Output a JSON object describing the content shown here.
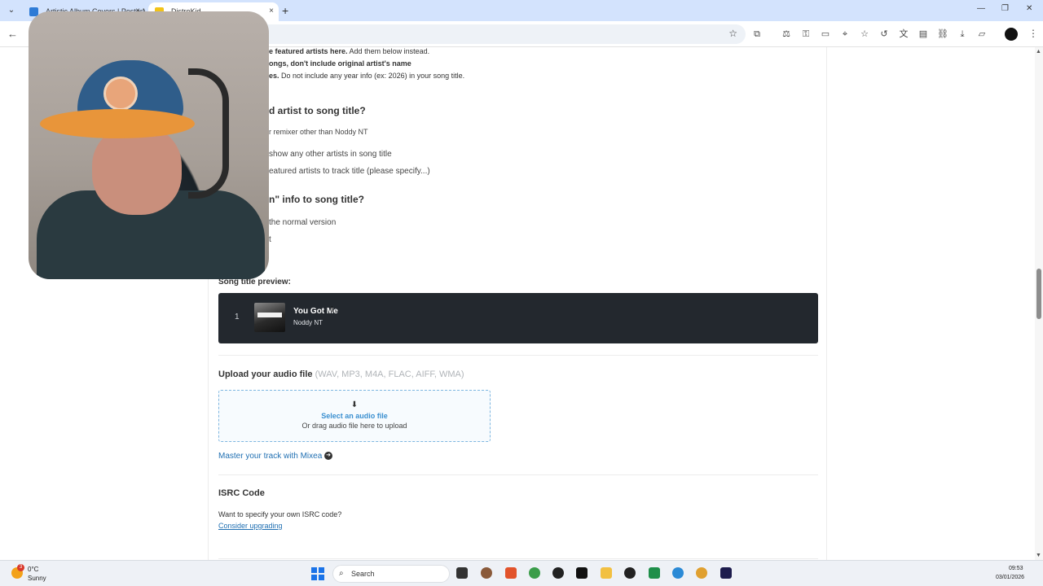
{
  "browser": {
    "tabs": [
      {
        "title": "Artistic Album Covers | PosterM"
      },
      {
        "title": "DistroKid"
      }
    ],
    "new_tab": "+",
    "tab_close": "×"
  },
  "form": {
    "rules": [
      {
        "bold": "e featured artists here.",
        "text": " Add them below instead."
      },
      {
        "bold": "ongs, don't include original artist's name",
        "text": ""
      },
      {
        "bold": "es.",
        "text": " Do not include any year info (ex: 2026) in your song title."
      }
    ],
    "question_artist": "d artist to song title?",
    "artist_options": [
      "r remixer other than Noddy NT",
      "show any other artists in song title",
      "eatured artists to track title (please specify...)"
    ],
    "question_version": "n\" info to song title?",
    "version_options": [
      "the normal version",
      "t"
    ],
    "preview_label": "Song title preview:",
    "preview": {
      "track_number": "1",
      "title": "You Got Me",
      "artist": "Noddy NT"
    },
    "upload": {
      "heading": "Upload your audio file",
      "formats": "(WAV, MP3, M4A, FLAC, AIFF, WMA)",
      "select_label": "Select an audio file",
      "drag_label": "Or drag audio file here to upload"
    },
    "mixea_link": "Master your track with Mixea",
    "isrc": {
      "heading": "ISRC Code",
      "question": "Want to specify your own ISRC code?",
      "link": "Consider upgrading"
    }
  },
  "taskbar": {
    "weather": {
      "temp": "0°C",
      "condition": "Sunny",
      "badge": "3"
    },
    "search_label": "Search",
    "clock": {
      "time": "09:53",
      "date": "03/01/2026"
    }
  },
  "colors": {
    "preview_card": "#23282e",
    "link": "#1f6fb2",
    "dropzone_border": "#7eb6e0",
    "tabbar": "#d3e3fd"
  }
}
